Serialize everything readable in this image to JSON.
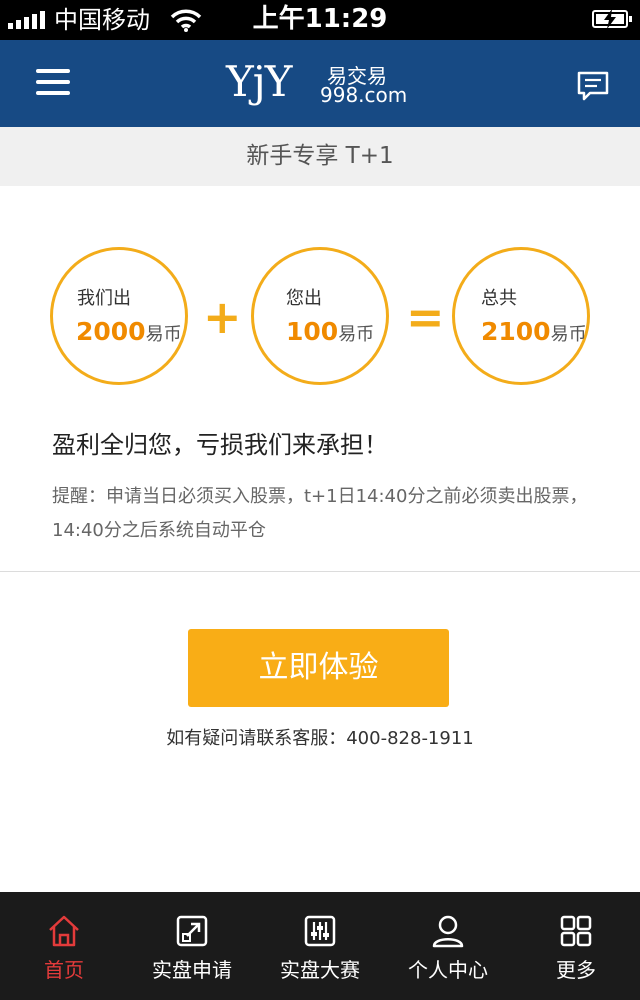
{
  "status_bar": {
    "carrier": "中国移动",
    "time": "上午11:29",
    "signal_icon": "signal-bars-icon",
    "wifi_icon": "wifi-icon",
    "battery_icon": "battery-charging-icon"
  },
  "header": {
    "logo_main": "YjY",
    "logo_cn": "易交易",
    "logo_domain": "998.com",
    "menu_icon": "hamburger-menu-icon",
    "message_icon": "message-icon",
    "background": "#174a84"
  },
  "subtitle": "新手专享 T+1",
  "offer": {
    "we_label": "我们出",
    "we_amount": "2000",
    "you_label": "您出",
    "you_amount": "100",
    "total_label": "总共",
    "total_amount": "2100",
    "unit": "易币",
    "plus": "+",
    "equals": "="
  },
  "profit_text": "盈利全归您，亏损我们来承担！",
  "reminder_text": "提醒：申请当日必须买入股票，t+1日14:40分之前必须卖出股票，14:40分之后系统自动平仓",
  "cta_label": "立即体验",
  "contact_text": "如有疑问请联系客服：400-828-1911",
  "tabs": [
    {
      "label": "首页",
      "icon": "home-icon",
      "active": true
    },
    {
      "label": "实盘申请",
      "icon": "external-link-icon",
      "active": false
    },
    {
      "label": "实盘大赛",
      "icon": "sliders-icon",
      "active": false
    },
    {
      "label": "个人中心",
      "icon": "user-icon",
      "active": false
    },
    {
      "label": "更多",
      "icon": "grid-icon",
      "active": false
    }
  ],
  "colors": {
    "accent": "#f3ac1a",
    "amount": "#f08a00",
    "button": "#f9ad16",
    "tab_active": "#e33b3b",
    "tabbar_bg": "#1b1b1b"
  }
}
